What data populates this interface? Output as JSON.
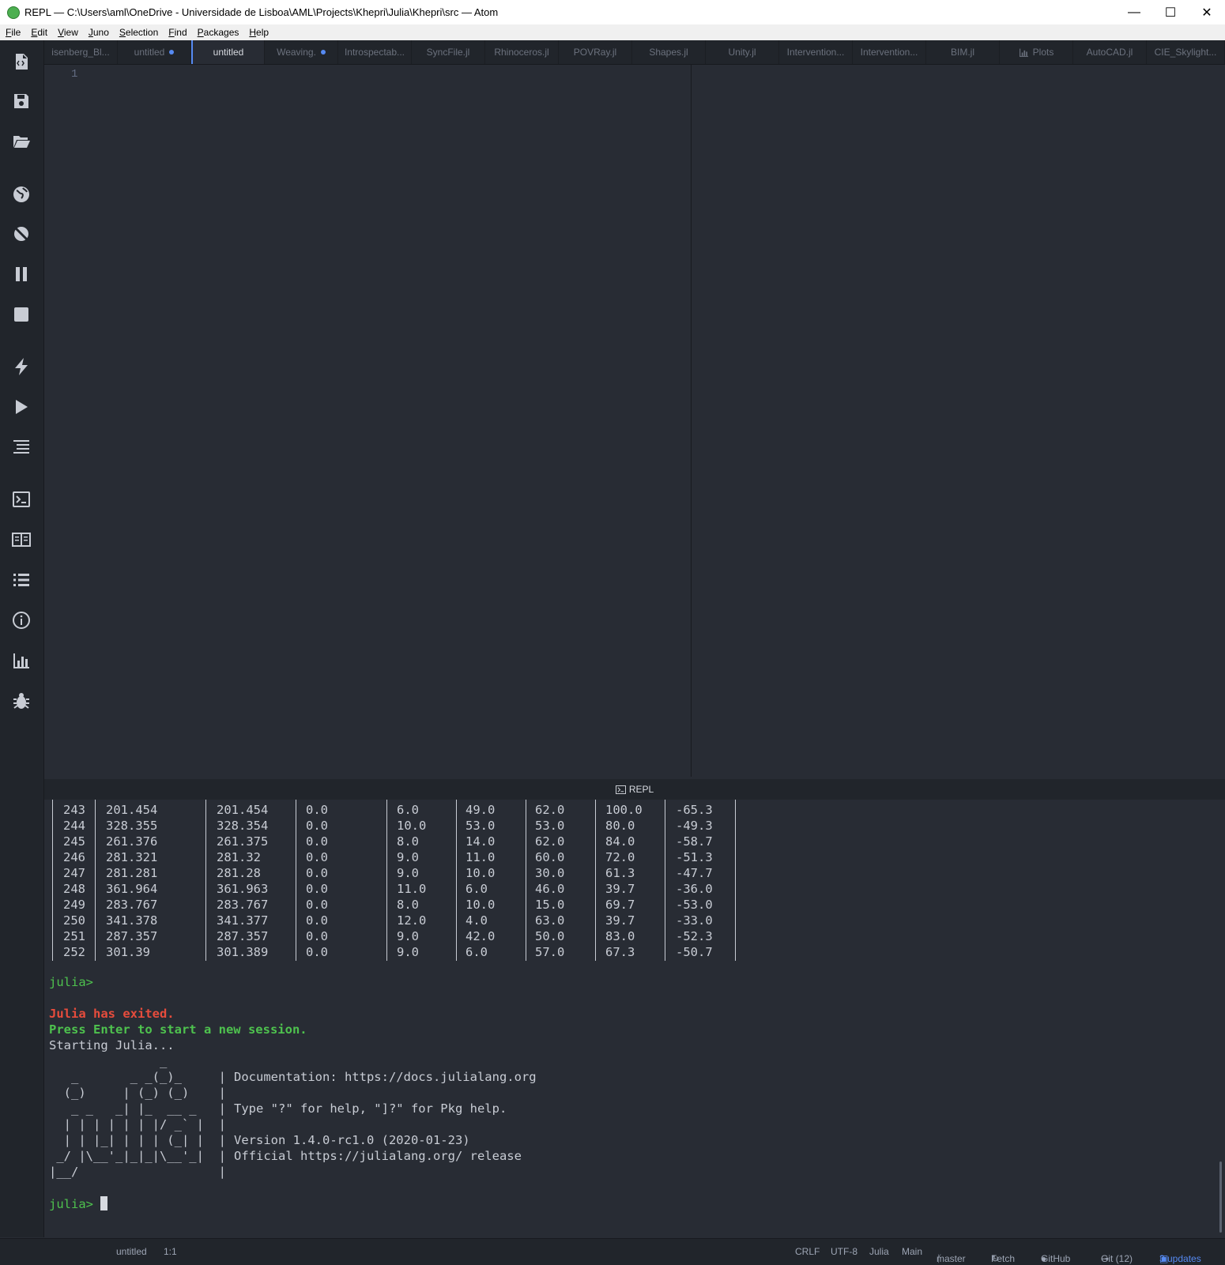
{
  "window": {
    "title": "REPL — C:\\Users\\aml\\OneDrive - Universidade de Lisboa\\AML\\Projects\\Khepri\\Julia\\Khepri\\src — Atom",
    "minimize": "—",
    "maximize": "☐",
    "close": "✕"
  },
  "menu": [
    "File",
    "Edit",
    "View",
    "Juno",
    "Selection",
    "Find",
    "Packages",
    "Help"
  ],
  "sidebar_icons": [
    "new-file-icon",
    "save-icon",
    "open-folder-icon",
    "globe-icon",
    "disconnect-icon",
    "pause-icon",
    "stop-icon",
    "lightning-icon",
    "play-icon",
    "format-icon",
    "terminal-icon",
    "book-icon",
    "list-icon",
    "info-icon",
    "chart-icon",
    "bug-icon"
  ],
  "tabs": [
    {
      "label": "isenberg_Bl...",
      "modified": false
    },
    {
      "label": "untitled",
      "modified": true
    },
    {
      "label": "untitled",
      "modified": false,
      "active": true
    },
    {
      "label": "Weaving.",
      "modified": true
    },
    {
      "label": "Introspectab...",
      "modified": false
    },
    {
      "label": "SyncFile.jl",
      "modified": false
    },
    {
      "label": "Rhinoceros.jl",
      "modified": false
    },
    {
      "label": "POVRay.jl",
      "modified": false
    },
    {
      "label": "Shapes.jl",
      "modified": false
    },
    {
      "label": "Unity.jl",
      "modified": false
    },
    {
      "label": "Intervention...",
      "modified": false
    },
    {
      "label": "Intervention...",
      "modified": false
    },
    {
      "label": "BIM.jl",
      "modified": false
    },
    {
      "label": "Plots",
      "modified": false
    },
    {
      "label": "AutoCAD.jl",
      "modified": false
    },
    {
      "label": "CIE_Skylight...",
      "modified": false
    }
  ],
  "editor": {
    "line_number": "1"
  },
  "repl": {
    "header": "REPL",
    "table_rows": [
      [
        "243",
        "201.454",
        "201.454",
        "0.0",
        "6.0",
        "49.0",
        "62.0",
        "100.0",
        "-65.3"
      ],
      [
        "244",
        "328.355",
        "328.354",
        "0.0",
        "10.0",
        "53.0",
        "53.0",
        "80.0",
        "-49.3"
      ],
      [
        "245",
        "261.376",
        "261.375",
        "0.0",
        "8.0",
        "14.0",
        "62.0",
        "84.0",
        "-58.7"
      ],
      [
        "246",
        "281.321",
        "281.32",
        "0.0",
        "9.0",
        "11.0",
        "60.0",
        "72.0",
        "-51.3"
      ],
      [
        "247",
        "281.281",
        "281.28",
        "0.0",
        "9.0",
        "10.0",
        "30.0",
        "61.3",
        "-47.7"
      ],
      [
        "248",
        "361.964",
        "361.963",
        "0.0",
        "11.0",
        "6.0",
        "46.0",
        "39.7",
        "-36.0"
      ],
      [
        "249",
        "283.767",
        "283.767",
        "0.0",
        "8.0",
        "10.0",
        "15.0",
        "69.7",
        "-53.0"
      ],
      [
        "250",
        "341.378",
        "341.377",
        "0.0",
        "12.0",
        "4.0",
        "63.0",
        "39.7",
        "-33.0"
      ],
      [
        "251",
        "287.357",
        "287.357",
        "0.0",
        "9.0",
        "42.0",
        "50.0",
        "83.0",
        "-52.3"
      ],
      [
        "252",
        "301.39",
        "301.389",
        "0.0",
        "9.0",
        "6.0",
        "57.0",
        "67.3",
        "-50.7"
      ]
    ],
    "prompt": "julia>",
    "exited": "Julia has exited.",
    "press_enter": "Press Enter to start a new session.",
    "starting": "Starting Julia...",
    "banner_logo": [
      "               _",
      "   _       _ _(_)_     |",
      "  (_)     | (_) (_)    |",
      "   _ _   _| |_  __ _   |",
      "  | | | | | | |/ _` |  |",
      "  | | |_| | | | (_| |  |",
      " _/ |\\__'_|_|_|\\__'_|  |",
      "|__/                   |"
    ],
    "banner_text": [
      "Documentation: https://docs.julialang.org",
      "Type \"?\" for help, \"]?\" for Pkg help.",
      "Version 1.4.0-rc1.0 (2020-01-23)",
      "Official https://julialang.org/ release"
    ],
    "prompt2": "julia>"
  },
  "status": {
    "file": "untitled",
    "cursor": "1:1",
    "line_ending": "CRLF",
    "encoding": "UTF-8",
    "grammar": "Julia",
    "module": "Main",
    "branch": "master",
    "fetch": "Fetch",
    "github": "GitHub",
    "git": "Git (12)",
    "updates": "3 updates"
  }
}
